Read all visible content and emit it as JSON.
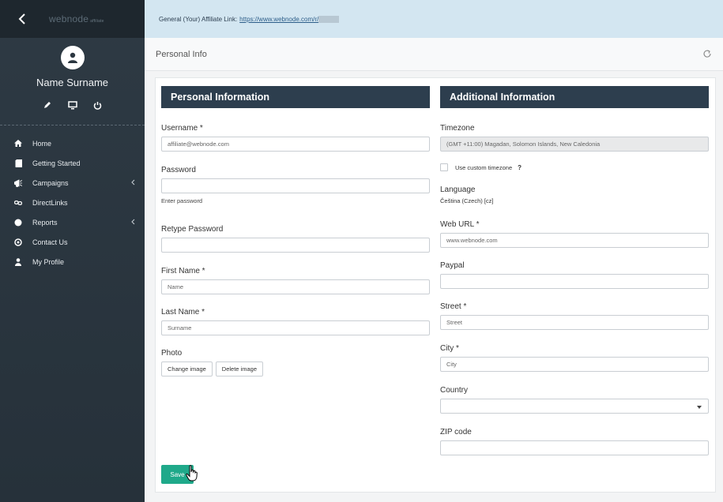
{
  "sidebar": {
    "logo": "webnode",
    "logo_suffix": "affiliate",
    "user_name": "Name Surname",
    "nav": [
      {
        "label": "Home",
        "icon": "home-icon"
      },
      {
        "label": "Getting Started",
        "icon": "book-icon"
      },
      {
        "label": "Campaigns",
        "icon": "megaphone-icon",
        "has_submenu": true
      },
      {
        "label": "DirectLinks",
        "icon": "link-icon"
      },
      {
        "label": "Reports",
        "icon": "pie-chart-icon",
        "has_submenu": true
      },
      {
        "label": "Contact Us",
        "icon": "at-icon"
      },
      {
        "label": "My Profile",
        "icon": "user-icon"
      }
    ]
  },
  "topbar": {
    "label": "General (Your) Affiliate Link:",
    "link": "https://www.webnode.com/r/"
  },
  "section": {
    "title": "Personal Info"
  },
  "personal": {
    "title": "Personal Information",
    "username_label": "Username *",
    "username_value": "affiliate@webnode.com",
    "password_label": "Password",
    "password_hint": "Enter password",
    "retype_label": "Retype Password",
    "first_name_label": "First Name *",
    "first_name_value": "Name",
    "last_name_label": "Last Name *",
    "last_name_value": "Surname",
    "photo_label": "Photo",
    "change_image": "Change image",
    "delete_image": "Delete image"
  },
  "additional": {
    "title": "Additional Information",
    "timezone_label": "Timezone",
    "timezone_value": "(GMT +11:00) Magadan, Solomon Islands, New Caledonia",
    "custom_tz_label": "Use custom timezone",
    "help_mark": "?",
    "language_label": "Language",
    "language_value": "Čeština (Czech) [cz]",
    "web_url_label": "Web URL *",
    "web_url_value": "www.webnode.com",
    "paypal_label": "Paypal",
    "street_label": "Street *",
    "street_value": "Street",
    "city_label": "City *",
    "city_value": "City",
    "country_label": "Country",
    "zip_label": "ZIP code"
  },
  "save_label": "Save",
  "colors": {
    "sidebar_bg": "#2b3640",
    "topbar_bg": "#d3e6f1",
    "panel_header": "#2d3e4e",
    "save_button": "#1fa98a"
  }
}
